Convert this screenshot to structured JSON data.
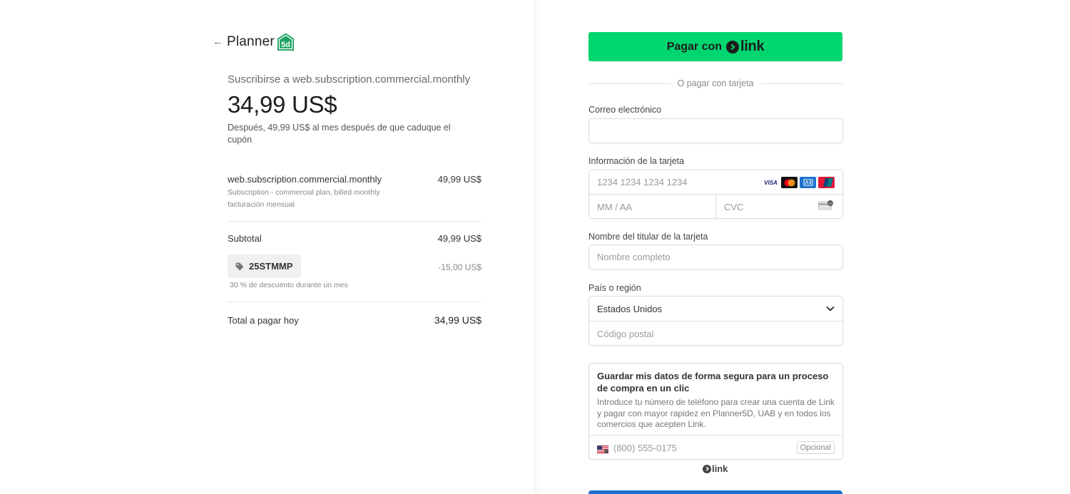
{
  "brand": {
    "name": "Planner",
    "badge": "5d",
    "color": "#1ea362"
  },
  "summary": {
    "subscribe_title": "Suscribirse a web.subscription.commercial.monthly",
    "price": "34,99 US$",
    "after_note": "Después, 49,99 US$ al mes después de que caduque el cupón",
    "line_item": {
      "name": "web.subscription.commercial.monthly",
      "price": "49,99 US$",
      "description_1": "Subscription - commercial plan, billed monthly",
      "description_2": "facturación mensual"
    },
    "subtotal_label": "Subtotal",
    "subtotal_value": "49,99 US$",
    "coupon_code": "25STMMP",
    "coupon_value": "-15,00 US$",
    "coupon_note": "30 % de descuento durante un mes",
    "total_label": "Total a pagar hoy",
    "total_value": "34,99 US$"
  },
  "payment": {
    "link_button_label": "Pagar con",
    "link_word": "link",
    "link_color": "#00d66f",
    "or_text": "O pagar con tarjeta",
    "email_label": "Correo electrónico",
    "email_value": "",
    "card_label": "Información de la tarjeta",
    "card_number_placeholder": "1234 1234 1234 1234",
    "expiry_placeholder": "MM / AA",
    "cvc_placeholder": "CVC",
    "card_brands": [
      "visa-icon",
      "mastercard-icon",
      "amex-icon",
      "unionpay-icon"
    ],
    "holder_label": "Nombre del titular de la tarjeta",
    "holder_placeholder": "Nombre completo",
    "country_label": "País o región",
    "country_value": "Estados Unidos",
    "zip_placeholder": "Código postal",
    "save_title": "Guardar mis datos de forma segura para un proceso de compra en un clic",
    "save_desc": "Introduce tu número de teléfono para crear una cuenta de Link y pagar con mayor rapidez en Planner5D, UAB y en todos los comercios que acepten Link.",
    "phone_placeholder": "(800) 555-0175",
    "optional_label": "Opcional",
    "footer_link_word": "link",
    "subscribe_color": "#1c6fd0"
  }
}
